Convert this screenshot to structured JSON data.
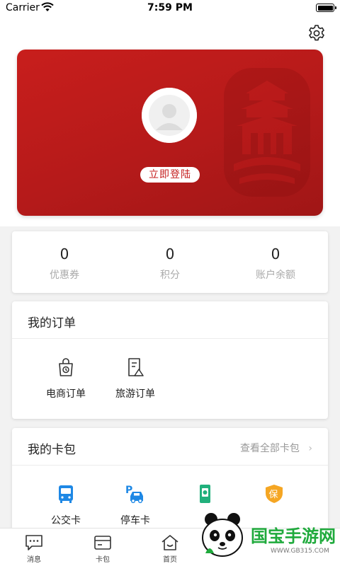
{
  "status_bar": {
    "carrier": "Carrier",
    "time": "7:59 PM"
  },
  "profile": {
    "login_label": "立即登陆"
  },
  "stats": [
    {
      "value": "0",
      "label": "优惠券"
    },
    {
      "value": "0",
      "label": "积分"
    },
    {
      "value": "0",
      "label": "账户余额"
    }
  ],
  "orders": {
    "title": "我的订单",
    "items": [
      {
        "label": "电商订单",
        "icon": "shopping-bag-icon"
      },
      {
        "label": "旅游订单",
        "icon": "travel-doc-icon"
      }
    ]
  },
  "cards": {
    "title": "我的卡包",
    "view_all": "查看全部卡包",
    "items": [
      {
        "label": "公交卡",
        "icon": "bus-icon"
      },
      {
        "label": "停车卡",
        "icon": "parking-car-icon"
      },
      {
        "label": "",
        "icon": "green-card-icon"
      },
      {
        "label": "",
        "icon": "insurance-shield-icon"
      }
    ]
  },
  "tabs": [
    {
      "label": "消息",
      "icon": "message-icon"
    },
    {
      "label": "卡包",
      "icon": "card-wallet-icon"
    },
    {
      "label": "首页",
      "icon": "home-icon"
    }
  ],
  "watermark": {
    "text": "国宝手游网",
    "url": "WWW.GB315.COM"
  },
  "colors": {
    "brand_red": "#c41c1c",
    "bus_blue": "#1e88e5",
    "insurance_orange": "#f5a623",
    "green_card": "#21b07c"
  }
}
